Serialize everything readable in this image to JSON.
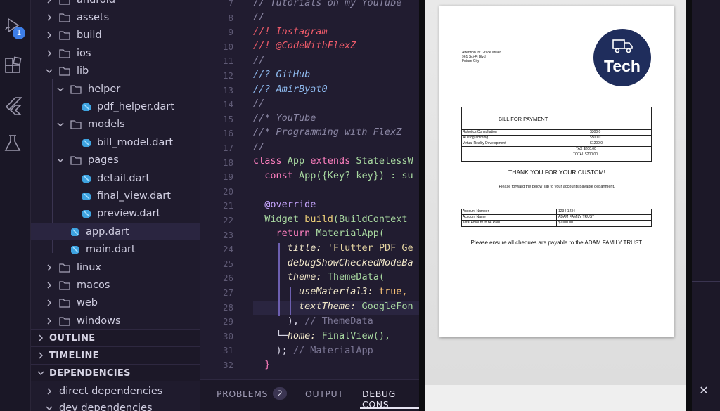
{
  "activity_bar": {
    "run_badge": "1",
    "icons": [
      "run-debug-icon",
      "extensions-icon",
      "flutter-icon",
      "testing-icon"
    ]
  },
  "explorer": {
    "items": [
      {
        "label": "android",
        "type": "folder",
        "expanded": false
      },
      {
        "label": "assets",
        "type": "folder",
        "expanded": false
      },
      {
        "label": "build",
        "type": "folder",
        "expanded": false
      },
      {
        "label": "ios",
        "type": "folder",
        "expanded": false
      },
      {
        "label": "lib",
        "type": "folder",
        "expanded": true
      },
      {
        "label": "helper",
        "type": "folder",
        "expanded": true
      },
      {
        "label": "pdf_helper.dart",
        "type": "dart"
      },
      {
        "label": "models",
        "type": "folder",
        "expanded": true
      },
      {
        "label": "bill_model.dart",
        "type": "dart"
      },
      {
        "label": "pages",
        "type": "folder",
        "expanded": true
      },
      {
        "label": "detail.dart",
        "type": "dart"
      },
      {
        "label": "final_view.dart",
        "type": "dart"
      },
      {
        "label": "preview.dart",
        "type": "dart"
      },
      {
        "label": "app.dart",
        "type": "dart",
        "selected": true
      },
      {
        "label": "main.dart",
        "type": "dart"
      },
      {
        "label": "linux",
        "type": "folder",
        "expanded": false
      },
      {
        "label": "macos",
        "type": "folder",
        "expanded": false
      },
      {
        "label": "web",
        "type": "folder",
        "expanded": false
      },
      {
        "label": "windows",
        "type": "folder",
        "expanded": false
      }
    ],
    "sections": {
      "outline": "OUTLINE",
      "timeline": "TIMELINE",
      "dependencies": "DEPENDENCIES"
    },
    "dependencies": {
      "direct": "direct dependencies",
      "dev": "dev dependencies"
    }
  },
  "editor": {
    "line_numbers": [
      "7",
      "8",
      "9",
      "10",
      "11",
      "12",
      "13",
      "14",
      "15",
      "16",
      "17",
      "18",
      "19",
      "20",
      "21",
      "22",
      "23",
      "24",
      "25",
      "26",
      "27",
      "28",
      "29",
      "30",
      "31",
      "32"
    ],
    "lines": {
      "l7": "// Tutorials on my YouTube",
      "l8": "//",
      "l9": "//! Instagram",
      "l10": "//! @CodeWithFlexZ",
      "l11": "//",
      "l12": "//? GitHub",
      "l13": "//? AmirByat0",
      "l14": "//",
      "l15": "//* YouTube",
      "l16": "//* Programming with FlexZ",
      "l17": "//",
      "l18_kw": "class",
      "l18_name": "App",
      "l18_ext": "extends",
      "l18_sup": "StatelessW",
      "l19_kw": "const",
      "l19_rest": "App({Key? key}) : su",
      "l21": "@override",
      "l22_cls": "Widget",
      "l22_fn": "build",
      "l22_rest": "(BuildContext",
      "l23_kw": "return",
      "l23_cls": "MaterialApp(",
      "l24_prop": "title:",
      "l24_str": "'Flutter PDF Ge",
      "l25_prop": "debugShowCheckedModeBa",
      "l26_prop": "theme:",
      "l26_cls": "ThemeData(",
      "l27_prop": "useMaterial3:",
      "l27_val": "true,",
      "l28_prop": "textTheme:",
      "l28_cls": "GoogleFon",
      "l29_punc": "),",
      "l29_cm": "// ThemeData",
      "l30_prop": "home:",
      "l30_cls": "FinalView(),",
      "l31_punc": ");",
      "l31_cm": "// MaterialApp",
      "l32": "}"
    }
  },
  "panel": {
    "tabs": [
      "PROBLEMS",
      "OUTPUT",
      "DEBUG CONS"
    ],
    "problems_count": "2",
    "active_tab": "DEBUG CONS"
  },
  "document": {
    "address": [
      "Attention to: Grace Miller",
      "961 Sci-Fi Blvd",
      "Future City"
    ],
    "logo_text": "Tech",
    "bill_title": "BILL FOR PAYMENT",
    "items": [
      {
        "desc": "Robotics Consultation",
        "amount": "$300.0"
      },
      {
        "desc": "AI Programming",
        "amount": "$500.0"
      },
      {
        "desc": "Virtual Reality Development",
        "amount": "$1200.0"
      }
    ],
    "tax_label": "TAX $200.00",
    "total_label": "TOTAL $200.00",
    "thanks": "THANK YOU FOR YOUR CUSTOM!",
    "forward_note": "Please forward the below slip to your accounts payable department.",
    "account": [
      {
        "label": "Account Number",
        "value": "1234-1234"
      },
      {
        "label": "Account Name",
        "value": "ADAM FAMILY TRUST"
      },
      {
        "label": "Total Amount to be Paid",
        "value": "$2000.00"
      }
    ],
    "cheque_note": "Please ensure all cheques are payable to the ADAM FAMILY TRUST."
  },
  "colors": {
    "accent": "#3d7ee8",
    "logo_bg": "#1f2d5c",
    "editor_bg": "#211c30"
  }
}
